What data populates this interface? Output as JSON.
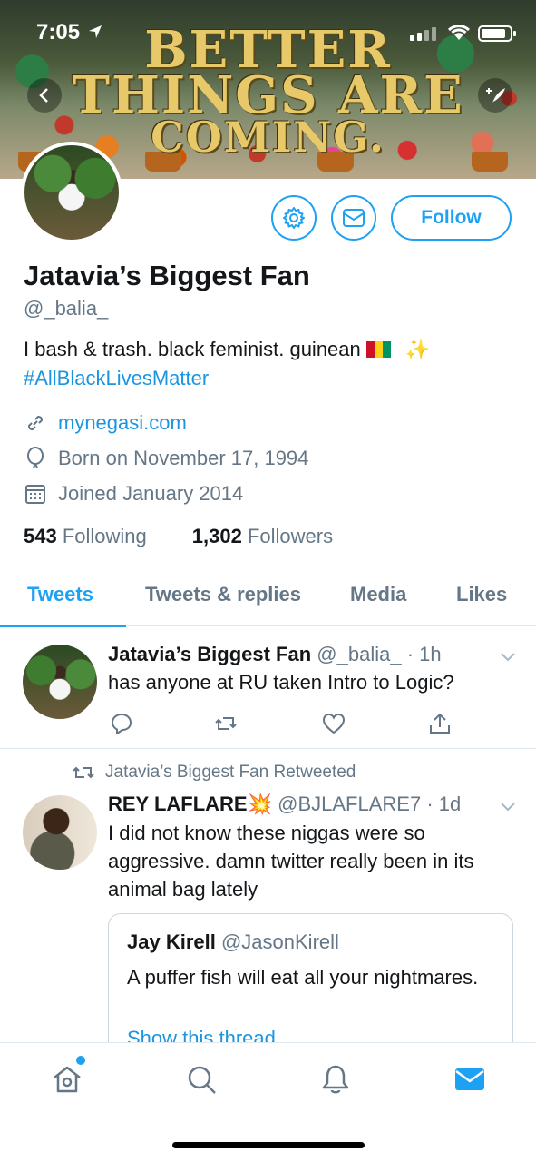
{
  "status_bar": {
    "time": "7:05"
  },
  "banner": {
    "line1": "BETTER",
    "line2": "THINGS ARE",
    "line3": "COMING."
  },
  "profile": {
    "follow_label": "Follow",
    "display_name": "Jatavia’s Biggest Fan",
    "handle": "@_balia_",
    "bio_text": "I bash & trash. black feminist. guinean",
    "bio_hashtag": "#AllBlackLivesMatter",
    "website": "mynegasi.com",
    "born": "Born on November 17, 1994",
    "joined": "Joined January 2014",
    "following_count": "543",
    "following_label": "Following",
    "followers_count": "1,302",
    "followers_label": "Followers"
  },
  "tabs": [
    {
      "label": "Tweets",
      "active": true
    },
    {
      "label": "Tweets & replies",
      "active": false
    },
    {
      "label": "Media",
      "active": false
    },
    {
      "label": "Likes",
      "active": false
    }
  ],
  "tweets": [
    {
      "author": "Jatavia’s Biggest Fan",
      "handle": "@_balia_",
      "time": "· 1h",
      "text": "has anyone at RU taken Intro to Logic?"
    },
    {
      "retweeted_by": "Jatavia’s Biggest Fan Retweeted",
      "author": "REY LAFLARE",
      "handle": "@BJLAFLARE7",
      "time": "· 1d",
      "text": "I did not know these niggas were so aggressive. damn twitter really been in its animal bag lately",
      "quote": {
        "author": "Jay Kirell",
        "handle": "@JasonKirell",
        "text": "A puffer fish will eat all your nightmares.",
        "link": "Show this thread"
      }
    }
  ],
  "colors": {
    "accent": "#1da1f2",
    "secondary_text": "#657786",
    "border": "#e1e8ed"
  },
  "icons": [
    "back-icon",
    "compose-icon",
    "settings-icon",
    "mail-icon",
    "link-icon",
    "balloon-icon",
    "calendar-icon",
    "reply-icon",
    "retweet-icon",
    "like-icon",
    "share-icon",
    "chevron-down-icon",
    "home-icon",
    "search-icon",
    "bell-icon",
    "envelope-icon"
  ]
}
